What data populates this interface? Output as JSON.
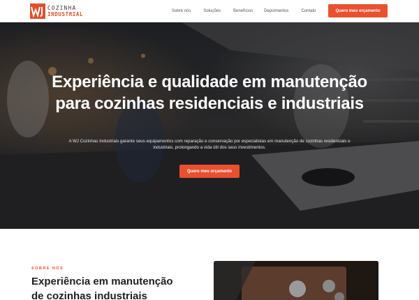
{
  "header": {
    "logo": {
      "line1": "COZINHA",
      "line2": "INDUSTRIAL",
      "mark": "WJ"
    },
    "nav": [
      {
        "label": "Sobre nós"
      },
      {
        "label": "Soluções"
      },
      {
        "label": "Benefícios"
      },
      {
        "label": "Depoimentos"
      },
      {
        "label": "Contato"
      }
    ],
    "cta_label": "Quero meu orçamento"
  },
  "hero": {
    "title": "Experiência e qualidade em manutenção para cozinhas residenciais e industriais",
    "description": "A WJ Cozinhas Industriais garante seus equipamentos com reparação e conservação por especialistas em manutenção de cozinhas residenciais e industriais, prolongando a vida útil dos seus investimentos.",
    "cta_label": "Quero meu orçamento"
  },
  "about": {
    "kicker": "SOBRE NÓS",
    "title": "Experiência em manutenção de cozinhas industriais"
  },
  "colors": {
    "accent": "#e8502f",
    "text_dark": "#1f1f1f",
    "hero_dark": "#15171a"
  }
}
